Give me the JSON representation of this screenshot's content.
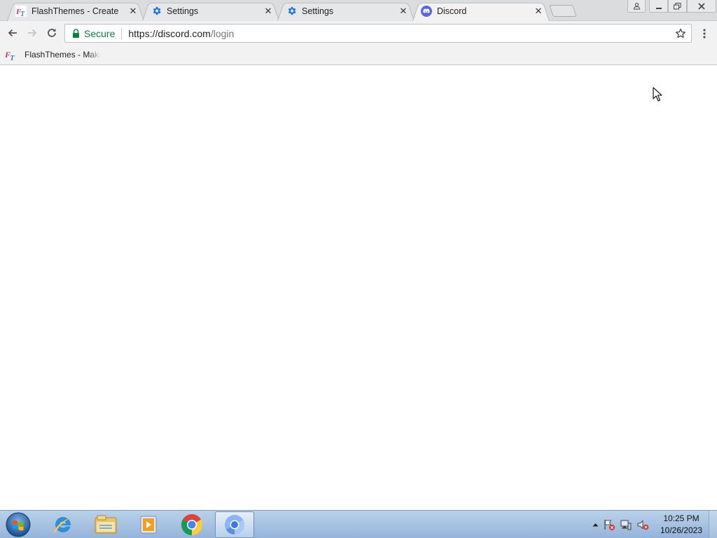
{
  "browser": {
    "tabs": [
      {
        "title": "FlashThemes - Create",
        "icon": "flashthemes-icon",
        "active": false
      },
      {
        "title": "Settings",
        "icon": "gear-icon",
        "active": false
      },
      {
        "title": "Settings",
        "icon": "gear-icon",
        "active": false
      },
      {
        "title": "Discord",
        "icon": "discord-icon",
        "active": true
      }
    ],
    "window_controls": {
      "profile": "profile-icon",
      "minimize": "minimize-icon",
      "restore": "restore-icon",
      "close": "close-icon"
    }
  },
  "toolbar": {
    "secure_label": "Secure",
    "url_host": "https://discord.com",
    "url_path": "/login",
    "secure_color": "#0b8043"
  },
  "bookmarks": [
    {
      "label": "FlashThemes - Make",
      "icon": "flashthemes-icon"
    }
  ],
  "page": {
    "content": ""
  },
  "taskbar": {
    "pinned": [
      {
        "name": "internet-explorer-icon"
      },
      {
        "name": "file-explorer-icon"
      },
      {
        "name": "media-player-icon"
      },
      {
        "name": "chrome-icon"
      },
      {
        "name": "chromium-icon",
        "active": true
      }
    ],
    "clock_time": "10:25 PM",
    "clock_date": "10/26/2023"
  },
  "colors": {
    "discord": "#5865f2",
    "settings_blue": "#1a73e8"
  }
}
